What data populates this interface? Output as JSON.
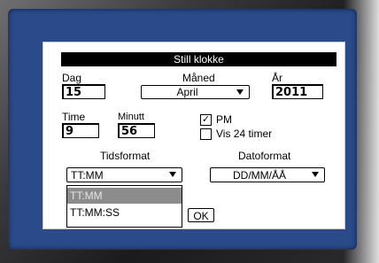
{
  "dialog": {
    "title": "Still klokke",
    "day": {
      "label": "Dag",
      "value": "15"
    },
    "month": {
      "label": "Måned",
      "value": "April"
    },
    "year": {
      "label": "År",
      "value": "2011"
    },
    "hour": {
      "label": "Time",
      "value": "9"
    },
    "minute": {
      "label": "Minutt",
      "value": "56"
    },
    "pm": {
      "label": "PM",
      "checked": true,
      "mark": "✓"
    },
    "vis24": {
      "label": "Vis 24 timer",
      "checked": false
    },
    "time_format": {
      "label": "Tidsformat",
      "value": "TT:MM",
      "options": [
        "TT:MM",
        "TT:MM:SS"
      ]
    },
    "date_format": {
      "label": "Datoformat",
      "value": "DD/MM/ÅÅ"
    },
    "ok_label": "OK"
  },
  "colors": {
    "screen": "#2a4a8a",
    "highlight": "#8c8c8c"
  }
}
